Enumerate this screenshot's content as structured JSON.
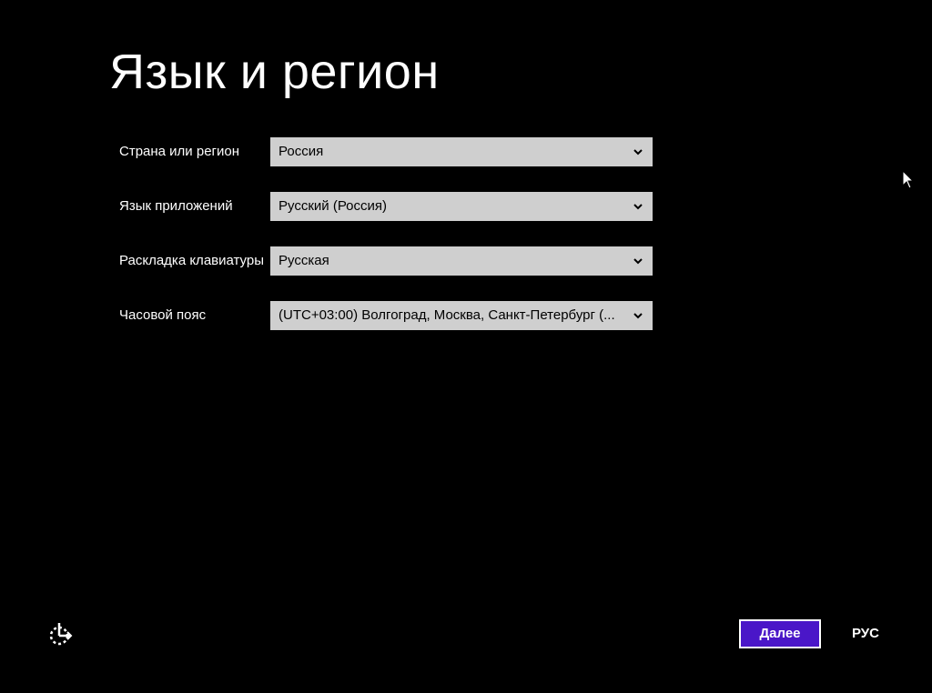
{
  "page": {
    "title": "Язык и регион"
  },
  "settings": [
    {
      "label": "Страна или регион",
      "value": "Россия"
    },
    {
      "label": "Язык приложений",
      "value": "Русский (Россия)"
    },
    {
      "label": "Раскладка клавиатуры",
      "value": "Русская"
    },
    {
      "label": "Часовой пояс",
      "value": "(UTC+03:00) Волгоград, Москва, Санкт-Петербург (..."
    }
  ],
  "footer": {
    "next_label": "Далее",
    "language_indicator": "РУС"
  },
  "icons": {
    "accessibility": "ease-of-access-icon",
    "dropdown": "chevron-down-icon",
    "cursor": "mouse-pointer-icon"
  },
  "colors": {
    "background": "#000000",
    "text": "#ffffff",
    "dropdown_bg": "#cfcfcf",
    "accent": "#4a16c8"
  }
}
